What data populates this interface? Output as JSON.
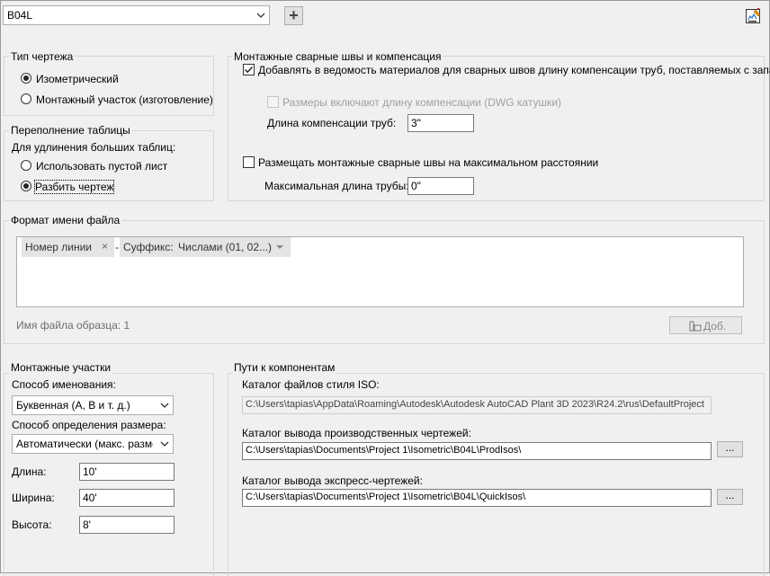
{
  "top": {
    "selector_value": "B04L",
    "add_symbol": "+"
  },
  "drawing_type": {
    "title": "Тип чертежа",
    "options": [
      {
        "label": "Изометрический",
        "selected": true
      },
      {
        "label": "Монтажный участок (изготовление)",
        "selected": false
      }
    ]
  },
  "table_overflow": {
    "title": "Переполнение таблицы",
    "prompt": "Для удлинения больших таблиц:",
    "options": [
      {
        "label": "Использовать пустой лист",
        "selected": false
      },
      {
        "label": "Разбить чертеж",
        "selected": true
      }
    ]
  },
  "field_welds": {
    "title": "Монтажные сварные швы и компенсация",
    "add_compensation": {
      "label": "Добавлять в ведомость материалов для сварных швов длину компенсации труб, поставляемых с запасом",
      "checked": true
    },
    "dims_include": {
      "label": "Размеры включают длину компенсации (DWG катушки)",
      "checked": false,
      "enabled": false
    },
    "compensation_length": {
      "label": "Длина компенсации труб:",
      "value": "3\""
    },
    "place_max_distance": {
      "label": "Размещать монтажные сварные швы на максимальном расстоянии",
      "checked": false
    },
    "max_pipe_length": {
      "label": "Максимальная длина трубы:",
      "value": "0\""
    }
  },
  "filename_format": {
    "title": "Формат имени файла",
    "chip_line": "Номер линии",
    "chip_remove": "×",
    "separator": "-",
    "suffix_label": "Суффикс:",
    "suffix_value": "Числами (01, 02...)",
    "sample": "Имя файла образца: 1",
    "add_button": "Доб."
  },
  "spools": {
    "title": "Монтажные участки",
    "naming_label": "Способ именования:",
    "naming_value": "Буквенная (А, В и т. д.)",
    "sizing_label": "Способ определения размера:",
    "sizing_value": "Автоматически (макс. размер",
    "length_label": "Длина:",
    "length_value": "10'",
    "width_label": "Ширина:",
    "width_value": "40'",
    "height_label": "Высота:",
    "height_value": "8'"
  },
  "paths": {
    "title": "Пути к компонентам",
    "iso_style_label": "Каталог файлов стиля ISO:",
    "iso_style_value": "C:\\Users\\tapias\\AppData\\Roaming\\Autodesk\\Autodesk AutoCAD Plant 3D 2023\\R24.2\\rus\\DefaultProject",
    "prod_label": "Каталог вывода производственных чертежей:",
    "prod_value": "C:\\Users\\tapias\\Documents\\Project 1\\Isometric\\B04L\\ProdIsos\\",
    "quick_label": "Каталог вывода экспресс-чертежей:",
    "quick_value": "C:\\Users\\tapias\\Documents\\Project 1\\Isometric\\B04L\\QuickIsos\\",
    "browse_label": "..."
  }
}
